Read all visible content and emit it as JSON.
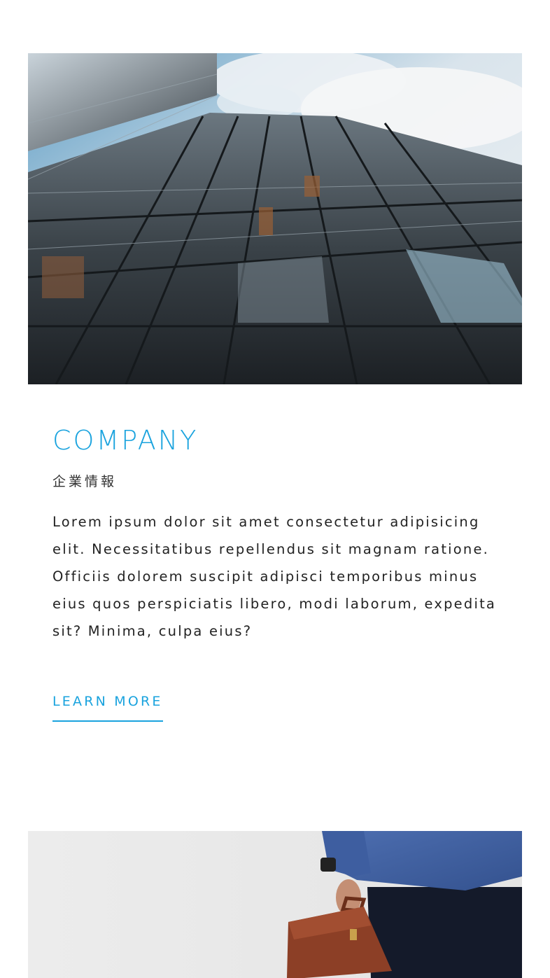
{
  "company_section": {
    "image_icon": "glass-skyscraper-photo",
    "title": "COMPANY",
    "subtitle": "企業情報",
    "body": "Lorem ipsum dolor sit amet consectetur adipisicing elit. Necessitatibus repellendus sit magnam ratione. Officiis dolorem suscipit adipisci temporibus minus eius quos perspiciatis libero, modi laborum, expedita sit? Minima, culpa eius?",
    "link_label": "LEARN MORE",
    "accent_color": "#1aa3de"
  },
  "next_section": {
    "image_icon": "businessman-with-briefcase-photo"
  }
}
